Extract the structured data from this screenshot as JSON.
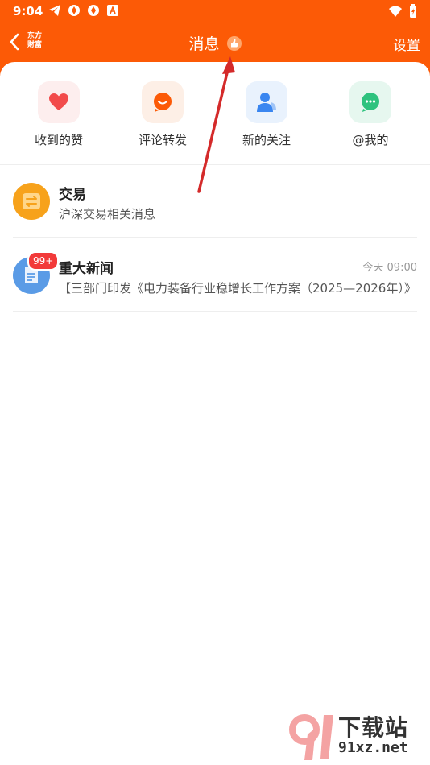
{
  "status_bar": {
    "time": "9:04"
  },
  "nav": {
    "logo_line1": "东方",
    "logo_line2": "财富",
    "title": "消息",
    "settings_label": "设置"
  },
  "quick_actions": [
    {
      "label": "收到的赞",
      "icon": "heart-icon",
      "bg": "#fdeeee",
      "color": "#f24b4b"
    },
    {
      "label": "评论转发",
      "icon": "comment-smile-icon",
      "bg": "#fdefe6",
      "color": "#fc5a06"
    },
    {
      "label": "新的关注",
      "icon": "user-follow-icon",
      "bg": "#e9f2fd",
      "color": "#3a86f0"
    },
    {
      "label": "@我的",
      "icon": "chat-dots-icon",
      "bg": "#e6f7ef",
      "color": "#2ec27e"
    }
  ],
  "messages": [
    {
      "title": "交易",
      "subtitle": "沪深交易相关消息",
      "time": "",
      "badge": "",
      "icon": "exchange-icon",
      "color": "#f7a21b"
    },
    {
      "title": "重大新闻",
      "subtitle": "【三部门印发《电力装备行业稳增长工作方案（2025—2026年）》",
      "time": "今天 09:00",
      "badge": "99+",
      "icon": "document-icon",
      "color": "#5a9be6"
    }
  ],
  "watermark": {
    "line1": "下载站",
    "line2": "91xz.net"
  }
}
